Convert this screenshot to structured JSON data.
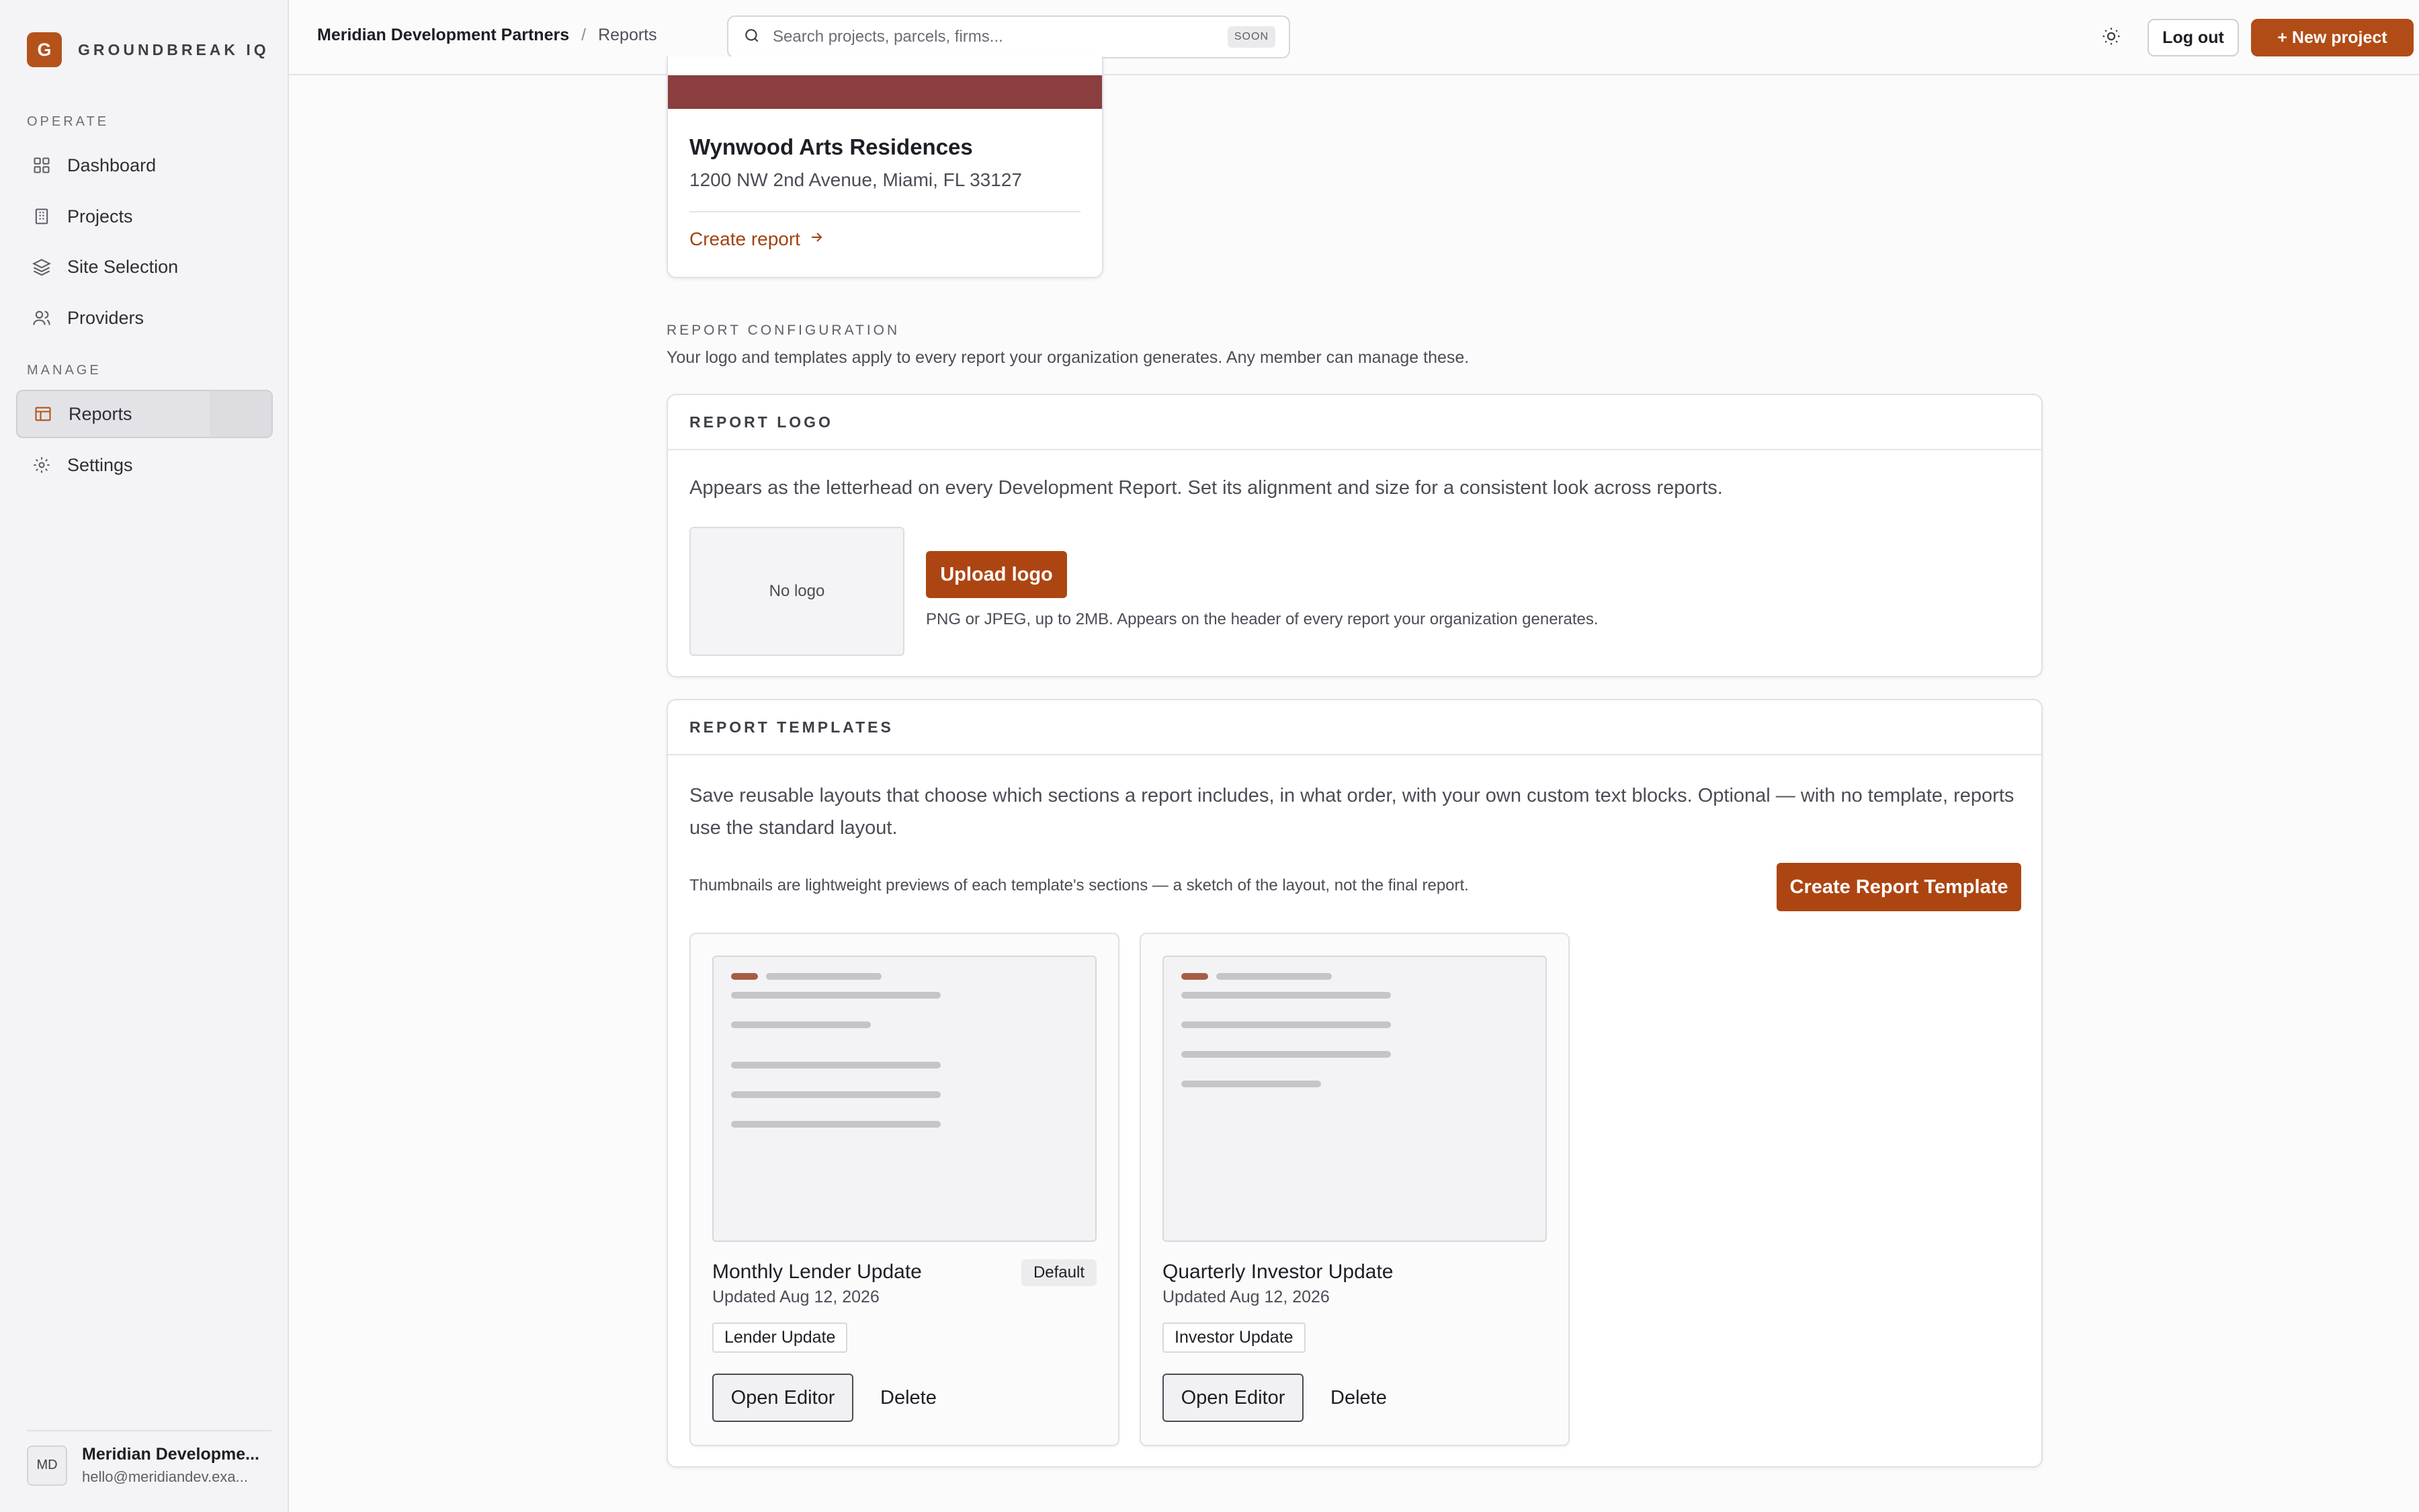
{
  "brand": {
    "initial": "G",
    "name": "GROUNDBREAK IQ"
  },
  "sidebar": {
    "groups": [
      {
        "label": "OPERATE"
      },
      {
        "label": "MANAGE"
      }
    ],
    "items": [
      {
        "label": "Dashboard",
        "icon": "grid-icon"
      },
      {
        "label": "Projects",
        "icon": "building-icon"
      },
      {
        "label": "Site Selection",
        "icon": "layers-icon"
      },
      {
        "label": "Providers",
        "icon": "users-icon"
      },
      {
        "label": "Reports",
        "icon": "table-icon",
        "active": true
      },
      {
        "label": "Settings",
        "icon": "gear-icon"
      }
    ],
    "user": {
      "initials": "MD",
      "name": "Meridian Developme...",
      "email": "hello@meridiandev.exa..."
    }
  },
  "topbar": {
    "breadcrumb": {
      "org": "Meridian Development Partners",
      "separator": "/",
      "page": "Reports"
    },
    "search": {
      "placeholder": "Search projects, parcels, firms...",
      "badge": "SOON"
    },
    "logout_label": "Log out",
    "new_project_label": "+ New project"
  },
  "project_card": {
    "name": "Wynwood Arts Residences",
    "address": "1200 NW 2nd Avenue, Miami, FL 33127",
    "create_report_label": "Create report"
  },
  "report_config": {
    "eyebrow": "REPORT CONFIGURATION",
    "description": "Your logo and templates apply to every report your organization generates. Any member can manage these."
  },
  "logo_panel": {
    "title": "REPORT LOGO",
    "description": "Appears as the letterhead on every Development Report. Set its alignment and size for a consistent look across reports.",
    "placeholder": "No logo",
    "upload_label": "Upload logo",
    "hint": "PNG or JPEG, up to 2MB. Appears on the header of every report your organization generates."
  },
  "templates_panel": {
    "title": "REPORT TEMPLATES",
    "description": "Save reusable layouts that choose which sections a report includes, in what order, with your own custom text blocks. Optional — with no template, reports use the standard layout.",
    "thumb_hint": "Thumbnails are lightweight previews of each template's sections — a sketch of the layout, not the final report.",
    "create_label": "Create Report Template",
    "templates": [
      {
        "name": "Monthly Lender Update",
        "updated": "Updated Aug 12, 2026",
        "tag": "Lender Update",
        "default_label": "Default",
        "open_label": "Open Editor",
        "delete_label": "Delete"
      },
      {
        "name": "Quarterly Investor Update",
        "updated": "Updated Aug 12, 2026",
        "tag": "Investor Update",
        "open_label": "Open Editor",
        "delete_label": "Delete"
      }
    ]
  },
  "colors": {
    "accent": "#ad4512",
    "banner": "#8a3e3e"
  }
}
